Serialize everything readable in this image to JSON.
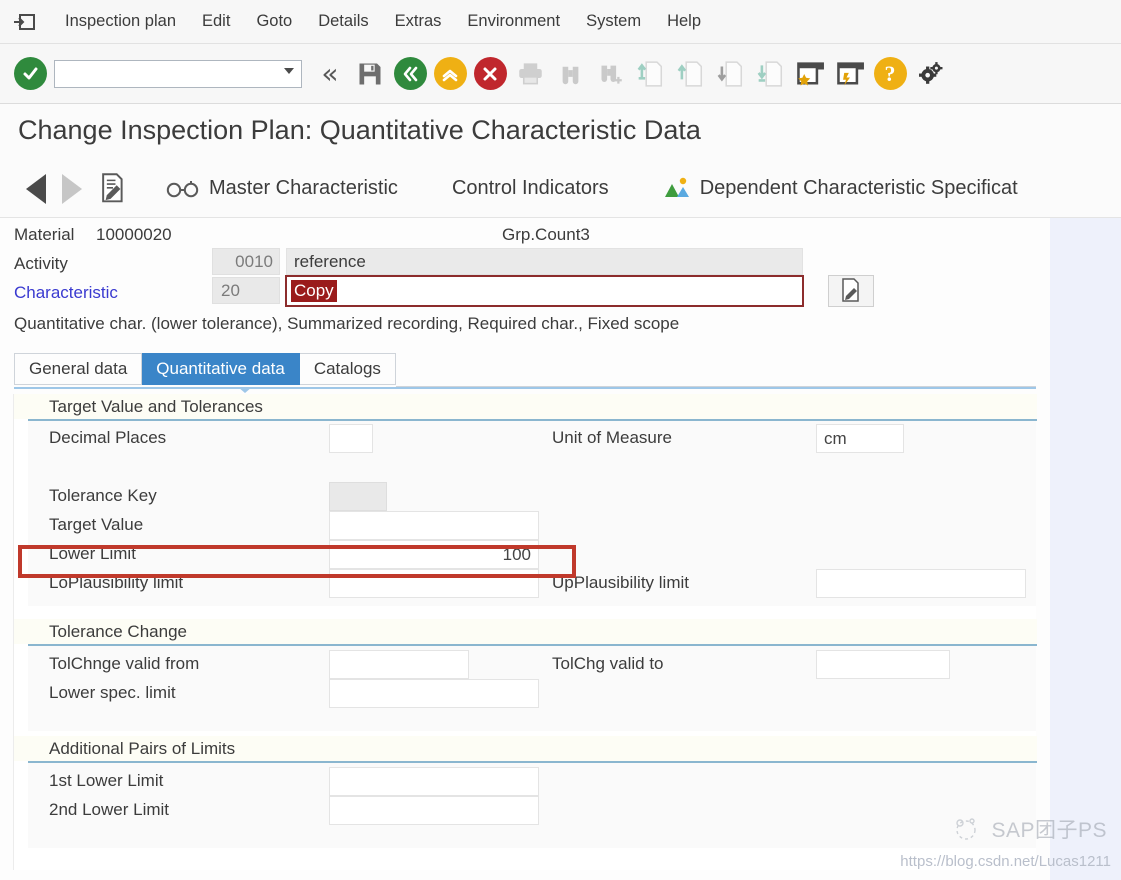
{
  "menu": {
    "system_icon": "sap-menu-icon",
    "items": [
      {
        "label": "Inspection plan",
        "accel": "I"
      },
      {
        "label": "Edit",
        "accel": "E"
      },
      {
        "label": "Goto",
        "accel": "G"
      },
      {
        "label": "Details",
        "accel": "D"
      },
      {
        "label": "Extras",
        "accel": "E"
      },
      {
        "label": "Environment",
        "accel": "v"
      },
      {
        "label": "System",
        "accel": "y"
      },
      {
        "label": "Help",
        "accel": "H"
      }
    ]
  },
  "toolbar": {
    "enter_icon": "green-check-icon",
    "command_field": {
      "value": "",
      "placeholder": ""
    },
    "back_chevrons_icon": "double-chevron-left-icon",
    "save_icon": "save-floppy-icon",
    "back_icon": "green-back-icon",
    "exit_icon": "yellow-up-icon",
    "cancel_icon": "red-cancel-icon",
    "print_icon": "print-icon",
    "find_icon": "find-binoculars-icon",
    "find_next_icon": "find-next-binoculars-icon",
    "first_page_icon": "first-page-icon",
    "previous_page_icon": "previous-page-icon",
    "next_page_icon": "next-page-icon",
    "last_page_icon": "last-page-icon",
    "create_session_icon": "create-session-icon",
    "create_shortcut_icon": "create-shortcut-icon",
    "help_icon": "help-question-icon",
    "customize_icon": "customize-gear-icon"
  },
  "title": "Change Inspection Plan: Quantitative Characteristic Data",
  "apptoolbar": {
    "back_icon": "previous-triangle-icon",
    "forward_icon": "next-triangle-icon",
    "long_text_icon": "long-text-edit-icon",
    "master_char_icon": "glasses-icon",
    "master_characteristic": "Master Characteristic",
    "control_indicators": "Control Indicators",
    "dependent_char_icon": "dependent-spec-icon",
    "dependent_characteristic": "Dependent Characteristic Specificat"
  },
  "header": {
    "material_label": "Material",
    "material_value": "10000020",
    "group_counter": "Grp.Count3",
    "activity_label": "Activity",
    "activity_key": "0010",
    "activity_text": "reference",
    "characteristic_label": "Characteristic",
    "characteristic_key": "20",
    "characteristic_text": "Copy",
    "long_text_button_icon": "long-text-edit-icon",
    "description": "Quantitative char. (lower tolerance), Summarized recording, Required char., Fixed scope"
  },
  "tabs": [
    {
      "label": "General data",
      "active": false
    },
    {
      "label": "Quantitative data",
      "active": true
    },
    {
      "label": "Catalogs",
      "active": false
    }
  ],
  "form": {
    "groups": [
      {
        "title": "Target Value and Tolerances",
        "rows": [
          {
            "label": "Decimal Places",
            "value": "",
            "label2": "Unit of Measure",
            "value2": "cm"
          },
          {
            "label": "Tolerance Key",
            "value": "",
            "disabled": true
          },
          {
            "label": "Target Value",
            "value": ""
          },
          {
            "label": "Lower Limit",
            "value": "100",
            "highlighted": true
          },
          {
            "label": "LoPlausibility limit",
            "value": "",
            "label2": "UpPlausibility limit",
            "value2": ""
          }
        ]
      },
      {
        "title": "Tolerance Change",
        "rows": [
          {
            "label": "TolChnge valid from",
            "value": "",
            "label2": "TolChg valid to",
            "value2": ""
          },
          {
            "label": "Lower spec. limit",
            "value": ""
          }
        ]
      },
      {
        "title": "Additional Pairs of Limits",
        "rows": [
          {
            "label": "1st Lower Limit",
            "value": ""
          },
          {
            "label": "2nd Lower Limit",
            "value": ""
          }
        ]
      }
    ]
  },
  "watermark": {
    "brand": "SAP团子PS",
    "url": "https://blog.csdn.net/Lucas1211"
  },
  "colors": {
    "accent_blue": "#3a85c8",
    "annotation_red": "#c0392b",
    "link_blue": "#3a3ad0",
    "selection_red": "#9a1b1b"
  }
}
